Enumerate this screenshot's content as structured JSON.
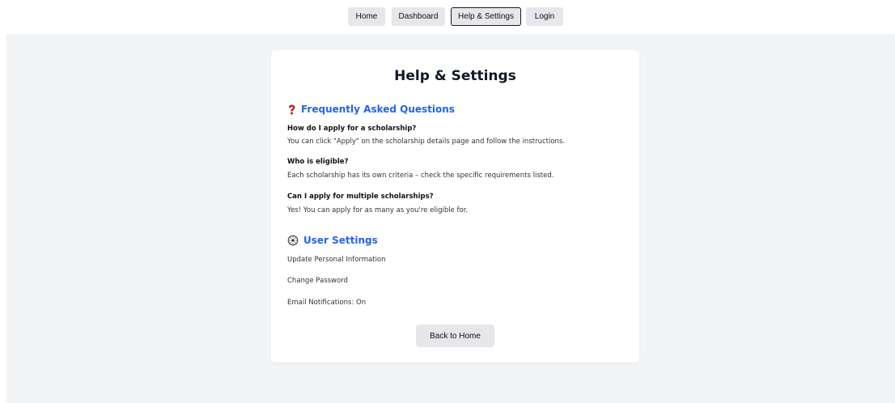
{
  "nav": {
    "home": "Home",
    "dashboard": "Dashboard",
    "help_settings": "Help & Settings",
    "login": "Login"
  },
  "page": {
    "title": "Help & Settings"
  },
  "faq": {
    "icon": "question-mark-icon",
    "heading": "Frequently Asked Questions",
    "items": [
      {
        "q": "How do I apply for a scholarship?",
        "a": "You can click \"Apply\" on the scholarship details page and follow the instructions."
      },
      {
        "q": "Who is eligible?",
        "a": "Each scholarship has its own criteria – check the specific requirements listed."
      },
      {
        "q": "Can I apply for multiple scholarships?",
        "a": "Yes! You can apply for as many as you're eligible for."
      }
    ]
  },
  "settings": {
    "icon": "gear-icon",
    "heading": "User Settings",
    "items": [
      "Update Personal Information",
      "Change Password",
      "Email Notifications: On"
    ]
  },
  "back_button": "Back to Home",
  "colors": {
    "accent": "#2563eb",
    "background": "#f3f4f6",
    "button": "#e5e7eb",
    "faq_icon": "#b91c1c"
  }
}
